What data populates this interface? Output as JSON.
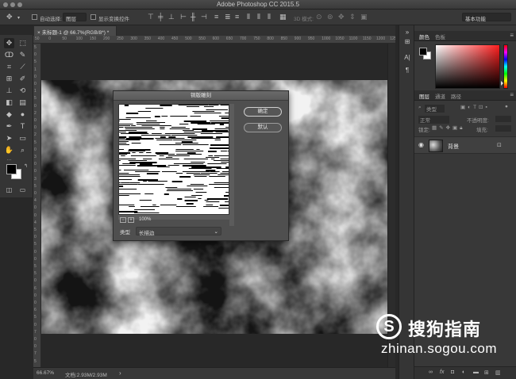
{
  "window": {
    "title": "Adobe Photoshop CC 2015.5"
  },
  "options_bar": {
    "auto_select_label": "自动选择:",
    "auto_select_value": "图层",
    "show_transform_label": "显示变换控件",
    "mode_3d_label": "3D 模式:",
    "workspace": "基本功能"
  },
  "document": {
    "tab_label": "未标题-1 @ 66.7%(RGB/8*) *",
    "ruler_h": [
      "50",
      "0",
      "50",
      "100",
      "150",
      "200",
      "250",
      "300",
      "350",
      "400",
      "450",
      "500",
      "550",
      "600",
      "650",
      "700",
      "750",
      "800",
      "850",
      "900",
      "950",
      "1000",
      "1050",
      "1100",
      "1150",
      "1200",
      "1250"
    ],
    "ruler_v": [
      "5",
      "0",
      "5",
      "1",
      "0",
      "0",
      "1",
      "5",
      "0",
      "2",
      "0",
      "0",
      "2",
      "5",
      "0",
      "3",
      "0",
      "0",
      "3",
      "5",
      "0",
      "4",
      "0",
      "0",
      "4",
      "5",
      "0",
      "5",
      "0",
      "0",
      "5",
      "5",
      "0",
      "6",
      "0",
      "0",
      "6",
      "5",
      "0",
      "7",
      "0",
      "0",
      "7",
      "5"
    ]
  },
  "status": {
    "zoom": "66.67%",
    "doc_info": "文档:2.93M/2.93M",
    "arrow": "›"
  },
  "dialog": {
    "title": "铜版雕刻",
    "ok_label": "确定",
    "default_label": "默认",
    "zoom_out": "−",
    "zoom_in": "+",
    "zoom_value": "100%",
    "type_label": "类型",
    "type_value": "长描边"
  },
  "panels": {
    "color_tab": "颜色",
    "swatches_tab": "色板",
    "layers_tab": "图层",
    "channels_tab": "通道",
    "paths_tab": "路径",
    "filter_kind": "类型",
    "blend_mode": "正常",
    "opacity_label": "不透明度:",
    "lock_label": "锁定:",
    "fill_label": "填充:",
    "layer_name": "背景"
  },
  "watermark": {
    "symbol": "S",
    "brand": "搜狗指南",
    "url": "zhinan.sogou.com"
  },
  "colors": {
    "foreground": "#000000",
    "background": "#ffffff",
    "hue": "#ff1e1e"
  }
}
